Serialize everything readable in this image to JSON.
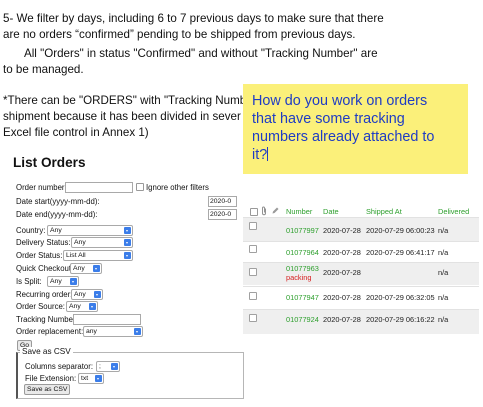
{
  "instructions": {
    "line1": "5- We filter by days, including 6 to 7 previous days to make sure that there",
    "line2": "are no orders “confirmed” pending to be shipped from previous days.",
    "line3": "All \"Orders\" in status \"Confirmed\" and without \"Tracking Number\" are",
    "line4": "to be managed.",
    "line5": "*There can be \"ORDERS\" with \"Tracking Numb",
    "line6": "shipment because it has been divided in sever",
    "line7": "Excel file control in Annex 1)"
  },
  "sticky_note": {
    "text": "How do you work on orders\nthat have some tracking\nnumbers already attached to\nit?"
  },
  "form": {
    "title": "List Orders",
    "order_number_label": "Order number:",
    "order_number_value": "",
    "ignore_filters_label": "Ignore other filters",
    "date_start_label": "Date start(yyyy-mm-dd):",
    "date_start_value": "2020-0",
    "date_end_label": "Date end(yyyy-mm-dd):",
    "date_end_value": "2020-0",
    "country_label": "Country:",
    "country_value": "Any",
    "delivery_status_label": "Delivery Status:",
    "delivery_status_value": "Any",
    "order_status_label": "Order Status:",
    "order_status_value": "List All",
    "quick_checkout_label": "Quick Checkout:",
    "quick_checkout_value": "Any",
    "is_split_label": "Is Split:",
    "is_split_value": "Any",
    "recurring_order_label": "Recurring order:",
    "recurring_order_value": "Any",
    "order_source_label": "Order Source:",
    "order_source_value": "Any",
    "tracking_number_label": "Tracking Number:",
    "tracking_number_value": "",
    "order_replacement_label": "Order replacement:",
    "order_replacement_value": "any",
    "go_label": "Go",
    "csv_legend": "Save as CSV",
    "columns_separator_label": "Columns separator:",
    "columns_separator_value": ";",
    "file_extension_label": "File Extension:",
    "file_extension_value": "txt",
    "save_csv_label": "Save as CSV"
  },
  "table": {
    "headers": {
      "number": "Number",
      "date": "Date",
      "shipped_at": "Shipped At",
      "delivered": "Delivered"
    },
    "rows": [
      {
        "number": "01077997",
        "status": "",
        "date": "2020-07-28",
        "shipped_at": "2020-07-29 06:00:23",
        "delivered": "n/a"
      },
      {
        "number": "01077964",
        "status": "",
        "date": "2020-07-28",
        "shipped_at": "2020-07-29 06:41:17",
        "delivered": "n/a"
      },
      {
        "number": "01077963",
        "status": "packing",
        "date": "2020-07-28",
        "shipped_at": "",
        "delivered": "n/a"
      },
      {
        "number": "01077947",
        "status": "",
        "date": "2020-07-28",
        "shipped_at": "2020-07-29 06:32:05",
        "delivered": "n/a"
      },
      {
        "number": "01077924",
        "status": "",
        "date": "2020-07-28",
        "shipped_at": "2020-07-29 06:16:22",
        "delivered": "n/a"
      }
    ]
  },
  "colors": {
    "sticky_bg": "#fbf07a",
    "sticky_text": "#1f3cc4",
    "table_accent": "#2d9f2d",
    "packing": "#d62020",
    "select_arrow": "#3b7de9"
  }
}
